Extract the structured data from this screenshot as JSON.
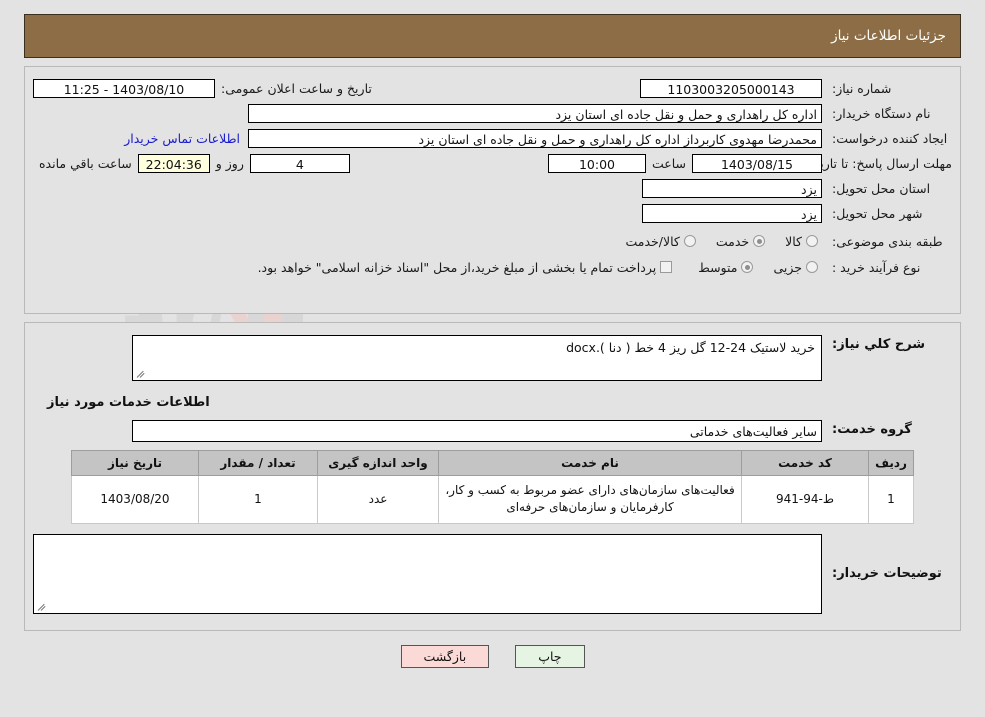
{
  "header": {
    "title": "جزئیات اطلاعات نیاز"
  },
  "form": {
    "need_no_label": "شماره نیاز:",
    "need_no_value": "1103003205000143",
    "pub_datetime_label": "تاریخ و ساعت اعلان عمومی:",
    "pub_datetime_value": "1403/08/10 - 11:25",
    "buyer_org_label": "نام دستگاه خریدار:",
    "buyer_org_value": "اداره کل راهداری و حمل و نقل جاده ای استان یزد",
    "creator_label": "ایجاد کننده درخواست:",
    "creator_value": "محمدرضا مهدوی کاربرداز اداره کل راهداری و حمل و نقل جاده ای استان یزد",
    "contact_link": "اطلاعات تماس خریدار",
    "deadline_label": "مهلت ارسال پاسخ: تا تاریخ:",
    "deadline_date": "1403/08/15",
    "hour_word": "ساعت",
    "deadline_time": "10:00",
    "days_value": "4",
    "days_word": "روز و",
    "countdown_value": "22:04:36",
    "remaining_word": "ساعت باقي مانده",
    "province_label": "استان محل تحویل:",
    "province_value": "یزد",
    "city_label": "شهر محل تحویل:",
    "city_value": "یزد",
    "category_label": "طبقه بندی موضوعی:",
    "category_options": [
      {
        "label": "کالا",
        "checked": false
      },
      {
        "label": "خدمت",
        "checked": true
      },
      {
        "label": "کالا/خدمت",
        "checked": false
      }
    ],
    "process_label": "نوع فرآیند خرید :",
    "process_options": [
      {
        "label": "جزیی",
        "checked": false
      },
      {
        "label": "متوسط",
        "checked": true
      }
    ],
    "treasury_checkbox_label": "پرداخت تمام یا بخشی از مبلغ خرید،از محل \"اسناد خزانه اسلامی\" خواهد بود.",
    "treasury_checked": false
  },
  "section2": {
    "desc_label": "شرح کلي نیاز:",
    "desc_value": "خرید لاستیک 24-12 گل ریز 4 خط ( دنا ).docx",
    "services_heading": "اطلاعات خدمات مورد نیاز",
    "group_label": "گروه خدمت:",
    "group_value": "سایر فعالیت‌های خدماتی",
    "notes_label": "توضیحات خریدار:",
    "notes_value": ""
  },
  "table": {
    "headers": [
      "ردیف",
      "کد خدمت",
      "نام خدمت",
      "واحد اندازه گیری",
      "تعداد / مقدار",
      "تاریخ نیاز"
    ],
    "rows": [
      {
        "index": "1",
        "code": "ط-94-941",
        "name": "فعالیت‌های سازمان‌های دارای عضو مربوط به کسب و کار، کارفرمایان و سازمان‌های حرفه‌ای",
        "unit": "عدد",
        "qty": "1",
        "date": "1403/08/20"
      }
    ]
  },
  "buttons": {
    "print": "چاپ",
    "back": "بازگشت"
  },
  "colors": {
    "header_band": "#8c6d45",
    "page_bg": "#e3e3e3",
    "link": "#1a1ad0",
    "countdown_bg": "#ffffdd",
    "print_btn_bg": "#e6f5e3",
    "back_btn_bg": "#fbd9d7",
    "table_header_bg": "#c4c4c4"
  }
}
